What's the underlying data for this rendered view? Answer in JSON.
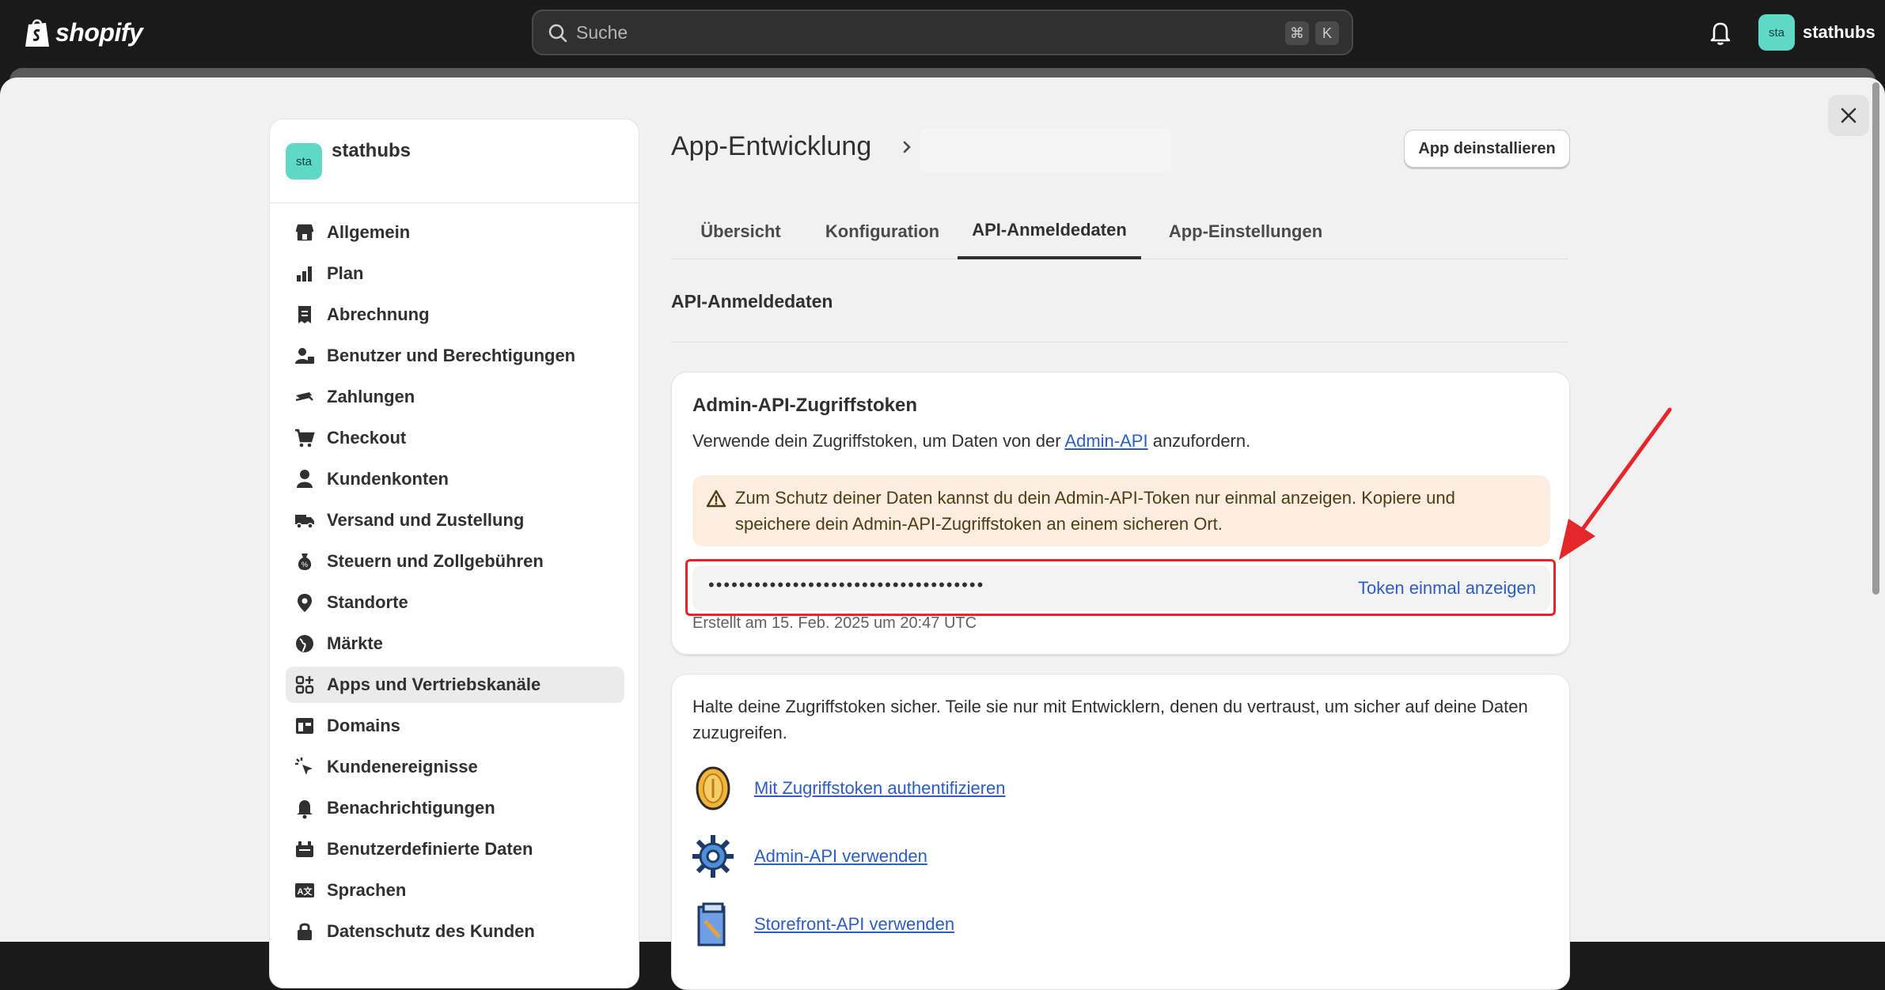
{
  "topbar": {
    "logo_text": "shopify",
    "search_placeholder": "Suche",
    "shortcut_cmd": "⌘",
    "shortcut_key": "K",
    "user_avatar": "sta",
    "user_name": "stathubs"
  },
  "sidebar": {
    "store_avatar": "sta",
    "store_name": "stathubs",
    "items": [
      {
        "label": "Allgemein",
        "icon": "store-icon"
      },
      {
        "label": "Plan",
        "icon": "plan-icon"
      },
      {
        "label": "Abrechnung",
        "icon": "receipt-icon"
      },
      {
        "label": "Benutzer und Berechtigungen",
        "icon": "users-icon"
      },
      {
        "label": "Zahlungen",
        "icon": "payments-icon"
      },
      {
        "label": "Checkout",
        "icon": "cart-icon"
      },
      {
        "label": "Kundenkonten",
        "icon": "person-icon"
      },
      {
        "label": "Versand und Zustellung",
        "icon": "truck-icon"
      },
      {
        "label": "Steuern und Zollgebühren",
        "icon": "money-bag-icon"
      },
      {
        "label": "Standorte",
        "icon": "location-icon"
      },
      {
        "label": "Märkte",
        "icon": "globe-icon"
      },
      {
        "label": "Apps und Vertriebskanäle",
        "icon": "apps-icon",
        "active": true
      },
      {
        "label": "Domains",
        "icon": "domain-icon"
      },
      {
        "label": "Kundenereignisse",
        "icon": "cursor-click-icon"
      },
      {
        "label": "Benachrichtigungen",
        "icon": "bell-icon"
      },
      {
        "label": "Benutzerdefinierte Daten",
        "icon": "database-icon"
      },
      {
        "label": "Sprachen",
        "icon": "language-icon"
      },
      {
        "label": "Datenschutz des Kunden",
        "icon": "lock-icon"
      }
    ]
  },
  "header": {
    "title": "App-Entwicklung",
    "uninstall_label": "App deinstallieren"
  },
  "tabs": [
    "Übersicht",
    "Konfiguration",
    "API-Anmeldedaten",
    "App-Einstellungen"
  ],
  "active_tab": "API-Anmeldedaten",
  "section_title": "API-Anmeldedaten",
  "token_card": {
    "title": "Admin-API-Zugriffstoken",
    "desc_before": "Verwende dein Zugriffstoken, um Daten von der ",
    "desc_link": "Admin-API",
    "desc_after": " anzufordern.",
    "warning": "Zum Schutz deiner Daten kannst du dein Admin-API-Token nur einmal anzeigen. Kopiere und speichere dein Admin-API-Zugriffstoken an einem sicheren Ort.",
    "token_masked": "••••••••••••••••••••••••••••••••••••",
    "show_token_label": "Token einmal anzeigen",
    "created": "Erstellt am 15. Feb. 2025 um 20:47 UTC"
  },
  "info_card": {
    "text": "Halte deine Zugriffstoken sicher. Teile sie nur mit Entwicklern, denen du vertraust, um sicher auf deine Daten zuzugreifen.",
    "links": [
      {
        "label": "Mit Zugriffstoken authentifizieren",
        "icon": "coin-icon"
      },
      {
        "label": "Admin-API verwenden",
        "icon": "gear-icon"
      },
      {
        "label": "Storefront-API verwenden",
        "icon": "scroll-icon"
      }
    ]
  },
  "colors": {
    "accent_link": "#2c5cc5",
    "avatar": "#5ed9c8",
    "warning_bg": "#fbeee0",
    "highlight": "#e5262b"
  }
}
